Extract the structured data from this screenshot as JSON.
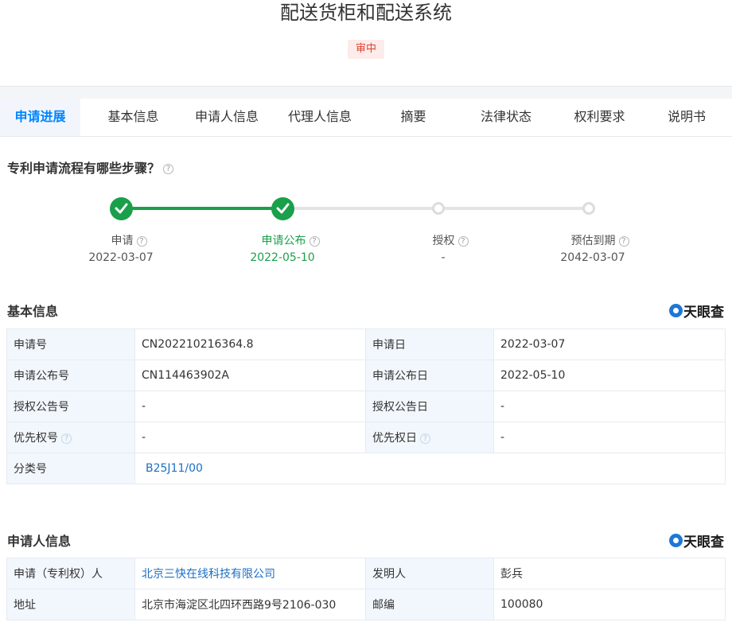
{
  "header": {
    "title": "配送货柜和配送系统",
    "status": "审中"
  },
  "tabs": [
    "申请进展",
    "基本信息",
    "申请人信息",
    "代理人信息",
    "摘要",
    "法律状态",
    "权利要求",
    "说明书"
  ],
  "progress": {
    "title": "专利申请流程有哪些步骤？",
    "steps": [
      {
        "label": "申请",
        "date": "2022-03-07",
        "done": true
      },
      {
        "label": "申请公布",
        "date": "2022-05-10",
        "done": true
      },
      {
        "label": "授权",
        "date": "-",
        "done": false
      },
      {
        "label": "预估到期",
        "date": "2042-03-07",
        "done": false
      }
    ]
  },
  "basic_info": {
    "title": "基本信息",
    "logo": "天眼查",
    "rows": [
      {
        "k1": "申请号",
        "v1": "CN202210216364.8",
        "k2": "申请日",
        "v2": "2022-03-07"
      },
      {
        "k1": "申请公布号",
        "v1": "CN114463902A",
        "k2": "申请公布日",
        "v2": "2022-05-10"
      },
      {
        "k1": "授权公告号",
        "v1": "-",
        "k2": "授权公告日",
        "v2": "-"
      },
      {
        "k1": "优先权号",
        "v1": "-",
        "k2": "优先权日",
        "v2": "-"
      }
    ],
    "class_label": "分类号",
    "class_value": "B25J11/00"
  },
  "applicant_info": {
    "title": "申请人信息",
    "logo": "天眼查",
    "rows": [
      {
        "k1": "申请（专利权）人",
        "v1": "北京三快在线科技有限公司",
        "k2": "发明人",
        "v2": "彭兵"
      },
      {
        "k1": "地址",
        "v1": "北京市海淀区北四环西路9号2106-030",
        "k2": "邮编",
        "v2": "100080"
      }
    ]
  },
  "colors": {
    "accent": "#0084ff",
    "done": "#1a9f4a",
    "badge_text": "#e0402f",
    "link": "#1c6fc4"
  },
  "icons": [
    "help-icon",
    "check-icon",
    "tianyancha-logo-icon"
  ]
}
